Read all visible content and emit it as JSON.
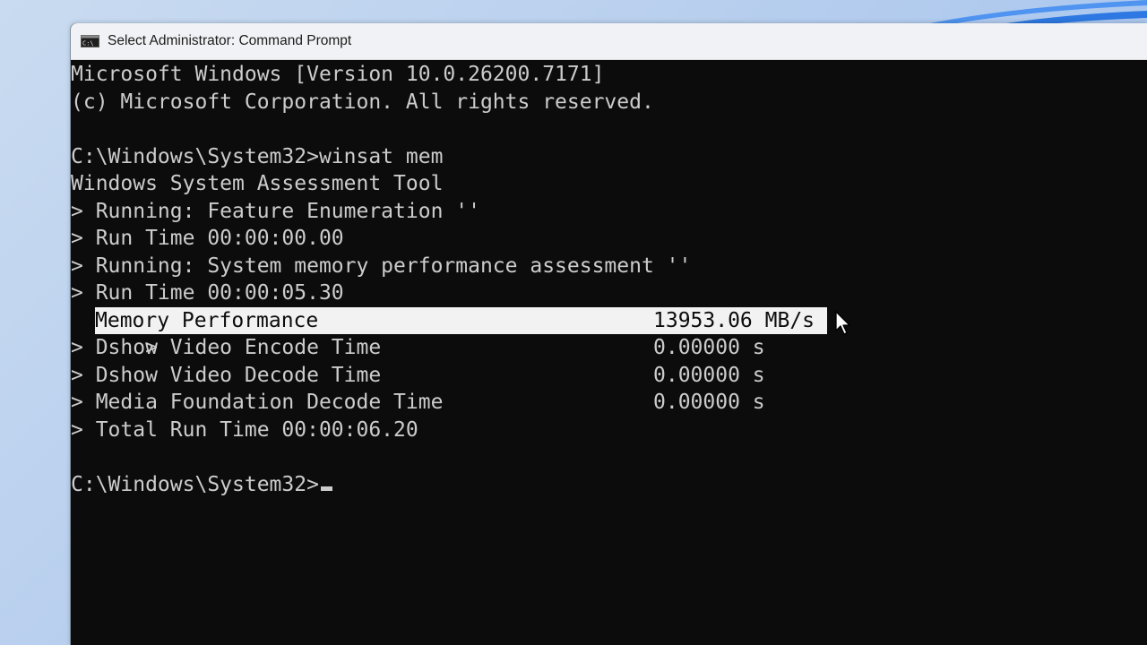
{
  "window": {
    "title": "Select Administrator: Command Prompt",
    "icon": "cmd-icon"
  },
  "console": {
    "lines": [
      "Microsoft Windows [Version 10.0.26200.7171]",
      "(c) Microsoft Corporation. All rights reserved.",
      "",
      "C:\\Windows\\System32>winsat mem",
      "Windows System Assessment Tool",
      "> Running: Feature Enumeration ''",
      "> Run Time 00:00:00.00",
      "> Running: System memory performance assessment ''",
      "> Run Time 00:00:05.30"
    ],
    "results": [
      {
        "prefix": "> ",
        "label": "Memory Performance",
        "value": "13953.06 MB/s",
        "selected": true
      },
      {
        "prefix": "> ",
        "label": "Dshow Video Encode Time",
        "value": "0.00000 s",
        "selected": false
      },
      {
        "prefix": "> ",
        "label": "Dshow Video Decode Time",
        "value": "0.00000 s",
        "selected": false
      },
      {
        "prefix": "> ",
        "label": "Media Foundation Decode Time",
        "value": "0.00000 s",
        "selected": false
      }
    ],
    "total_line": "> Total Run Time 00:00:06.20",
    "prompt": "C:\\Windows\\System32>"
  },
  "colors": {
    "console_bg": "#0c0c0c",
    "console_text": "#cccccc",
    "selection_bg": "#f2f2f2",
    "titlebar_bg": "#f1f2f5"
  }
}
